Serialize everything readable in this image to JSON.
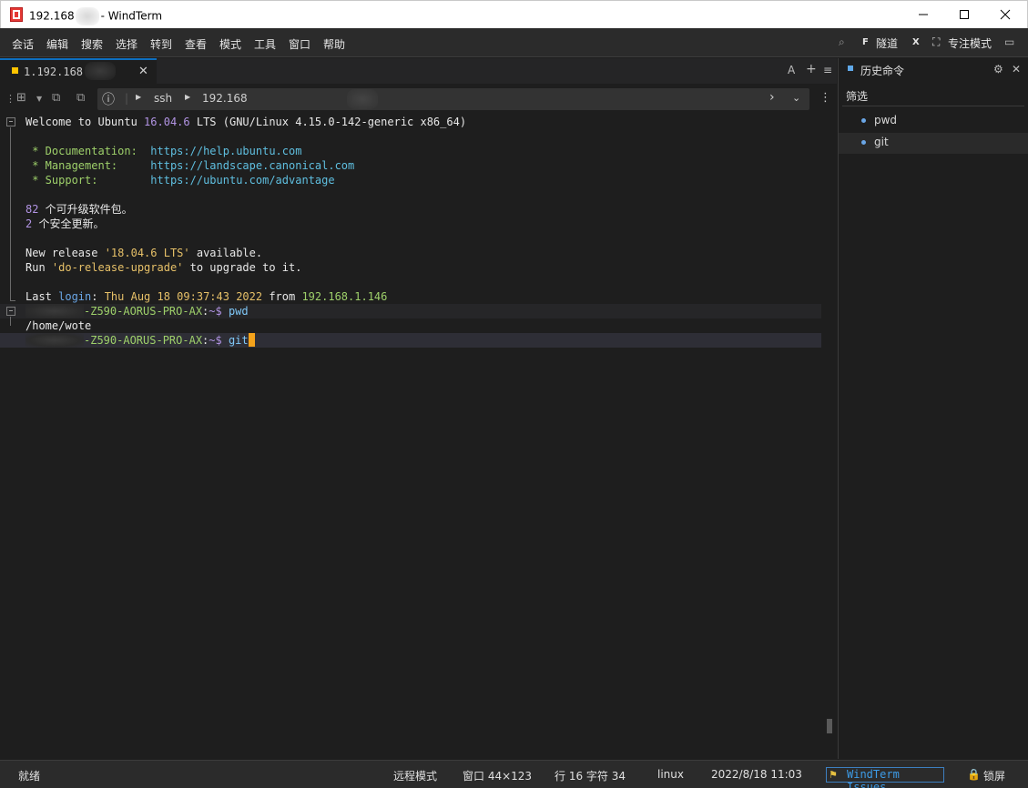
{
  "window": {
    "title_prefix": "192.168",
    "title_suffix": "- WindTerm"
  },
  "menu": {
    "items": [
      "会话",
      "编辑",
      "搜索",
      "选择",
      "转到",
      "查看",
      "模式",
      "工具",
      "窗口",
      "帮助"
    ],
    "tunnel": "隧道",
    "focus_mode": "专注模式"
  },
  "tab": {
    "label": "1.192.168",
    "close": "✕",
    "tools": {
      "font": "A",
      "add": "+",
      "menu": "≡"
    }
  },
  "address": {
    "protocol": "ssh",
    "host": "192.168"
  },
  "terminal": {
    "welcome": {
      "a": "Welcome to Ubuntu ",
      "ver": "16.04.6",
      "b": " LTS (GNU/Linux 4.15.0-142-generic x86_64)"
    },
    "doc": {
      "label": " * Documentation:  ",
      "url": "https://help.ubuntu.com"
    },
    "mgmt": {
      "label": " * Management:     ",
      "url": "https://landscape.canonical.com"
    },
    "support": {
      "label": " * Support:        ",
      "url": "https://ubuntu.com/advantage"
    },
    "upg1": {
      "num": "82",
      "text": " 个可升级软件包。"
    },
    "upg2": {
      "num": "2",
      "text": " 个安全更新。"
    },
    "release": {
      "a": "New release ",
      "q": "'18.04.6 LTS'",
      "b": " available."
    },
    "run": {
      "a": "Run ",
      "q": "'do-release-upgrade'",
      "b": " to upgrade to it."
    },
    "last": {
      "a": "Last ",
      "login": "login",
      "colon": ":",
      "date": " Thu Aug 18 09:37:43 2022 ",
      "from": "from ",
      "ip": "192.168.1.146"
    },
    "prompt1": {
      "host": "-Z590-AORUS-PRO-AX",
      "colon": ":",
      "path": "~$",
      "cmd": " pwd"
    },
    "output1": "/home/wote",
    "prompt2": {
      "host": "-Z590-AORUS-PRO-AX",
      "colon": ":",
      "path": "~$",
      "cmd": " git"
    }
  },
  "history_panel": {
    "title": "历史命令",
    "filter": "筛选",
    "items": [
      "pwd",
      "git"
    ]
  },
  "status": {
    "ready": "就绪",
    "remote_mode": "远程模式",
    "window": "窗口 44×123",
    "position": "行 16 字符 34",
    "os": "linux",
    "datetime": "2022/8/18 11:03",
    "issues": "WindTerm Issues",
    "lock": "锁屏"
  },
  "colors": {
    "accent": "#0e6fbf",
    "tab_dot": "#ffc400",
    "cursor": "#f4a21b",
    "prompt_host": "#9ed06a",
    "url": "#5fbfe0"
  }
}
